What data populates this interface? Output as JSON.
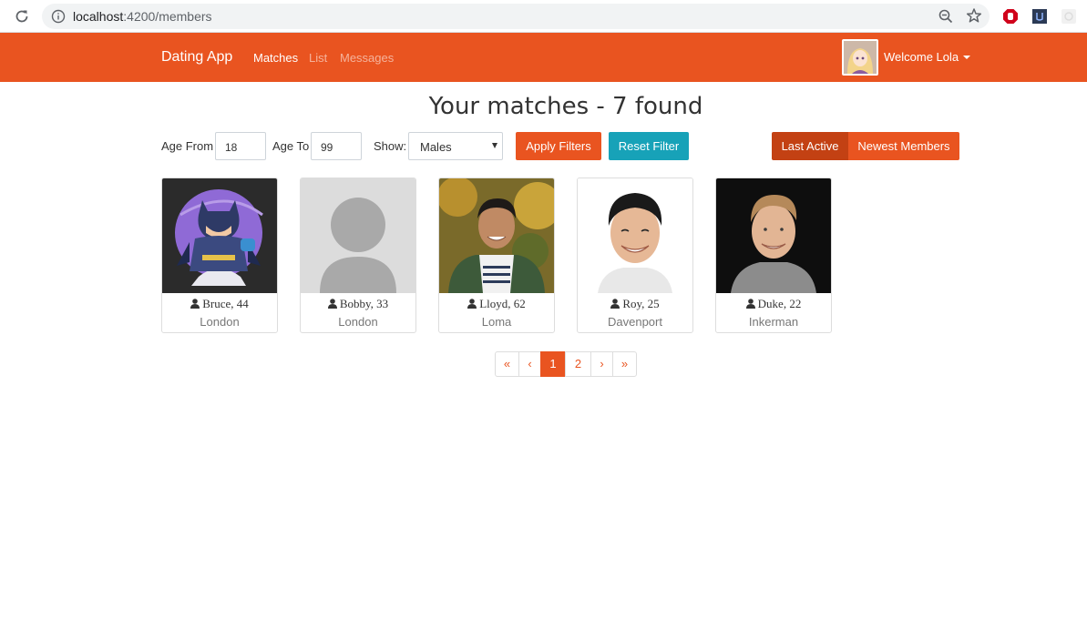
{
  "browser": {
    "url_host": "localhost",
    "url_path": ":4200/members"
  },
  "navbar": {
    "brand": "Dating App",
    "links": [
      "Matches",
      "List",
      "Messages"
    ],
    "welcome": "Welcome Lola"
  },
  "heading": "Your matches - 7 found",
  "filters": {
    "age_from_label": "Age From",
    "age_from_value": "18",
    "age_to_label": "Age To",
    "age_to_value": "99",
    "show_label": "Show:",
    "show_value": "Males",
    "apply_label": "Apply Filters",
    "reset_label": "Reset Filter",
    "sort_last_active": "Last Active",
    "sort_newest": "Newest Members"
  },
  "members": [
    {
      "name": "Bruce, 44",
      "city": "London"
    },
    {
      "name": "Bobby, 33",
      "city": "London"
    },
    {
      "name": "Lloyd, 62",
      "city": "Loma"
    },
    {
      "name": "Roy, 25",
      "city": "Davenport"
    },
    {
      "name": "Duke, 22",
      "city": "Inkerman"
    }
  ],
  "pagination": {
    "first": "«",
    "prev": "‹",
    "pages": [
      "1",
      "2"
    ],
    "current": "1",
    "next": "›",
    "last": "»"
  },
  "colors": {
    "primary": "#e95420",
    "primary_dark": "#c34113",
    "info": "#17a2b8"
  }
}
